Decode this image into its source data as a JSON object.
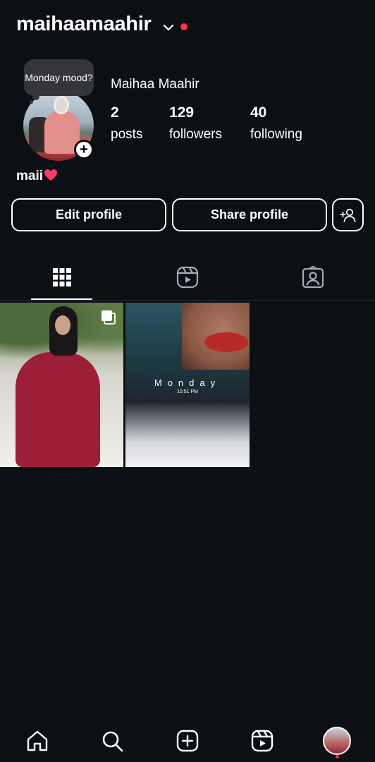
{
  "header": {
    "username": "maihaamaahir",
    "chevron_icon": "chevron-down-icon",
    "notification_dot_color": "#ff3040"
  },
  "profile": {
    "note_text": "Monday mood?",
    "display_name": "Maihaa Maahir",
    "stats": [
      {
        "value": "2",
        "label": "posts"
      },
      {
        "value": "129",
        "label": "followers"
      },
      {
        "value": "40",
        "label": "following"
      }
    ],
    "bio": "maii",
    "bio_emoji_icon": "red-heart-icon"
  },
  "actions": {
    "edit_profile": "Edit profile",
    "share_profile": "Share profile",
    "discover_people_icon": "add-person-icon"
  },
  "tabs": [
    {
      "icon": "grid-icon",
      "active": true
    },
    {
      "icon": "reels-icon",
      "active": false
    },
    {
      "icon": "tagged-icon",
      "active": false
    }
  ],
  "posts": [
    {
      "type": "carousel"
    },
    {
      "type": "photo",
      "overlay_day": "Monday",
      "overlay_time": "10:51 PM"
    }
  ],
  "bottom_nav": [
    {
      "icon": "home-icon"
    },
    {
      "icon": "search-icon"
    },
    {
      "icon": "create-icon"
    },
    {
      "icon": "reels-icon"
    },
    {
      "icon": "profile-avatar"
    }
  ],
  "colors": {
    "background": "#0c0f14",
    "text": "#ffffff",
    "accent_red": "#ff3040"
  }
}
